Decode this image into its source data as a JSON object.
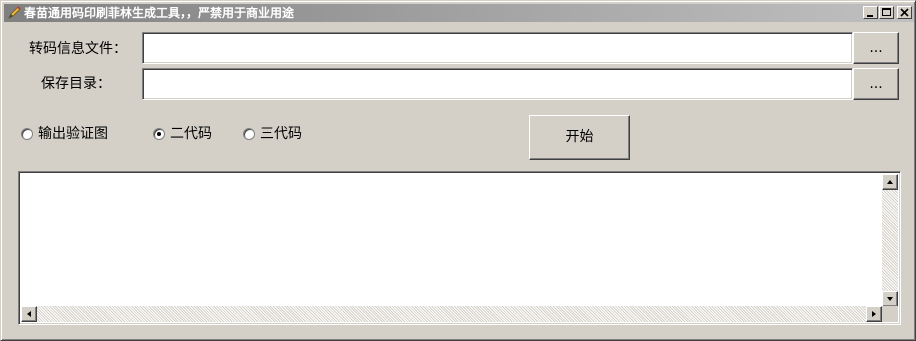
{
  "window": {
    "title": "春苗通用码印刷菲林生成工具，，严禁用于商业用途"
  },
  "form": {
    "file_label": "转码信息文件：",
    "file_value": "",
    "dir_label": "保存目录：",
    "dir_value": "",
    "browse_label": "..."
  },
  "options": {
    "verify_label": "输出验证图",
    "second_gen_label": "二代码",
    "third_gen_label": "三代码",
    "selected": "二代码"
  },
  "actions": {
    "start_label": "开始"
  },
  "log": {
    "content": ""
  },
  "icons": {
    "app": "pencil-icon",
    "minimize": "minimize-icon",
    "maximize": "maximize-icon",
    "close": "close-icon"
  }
}
